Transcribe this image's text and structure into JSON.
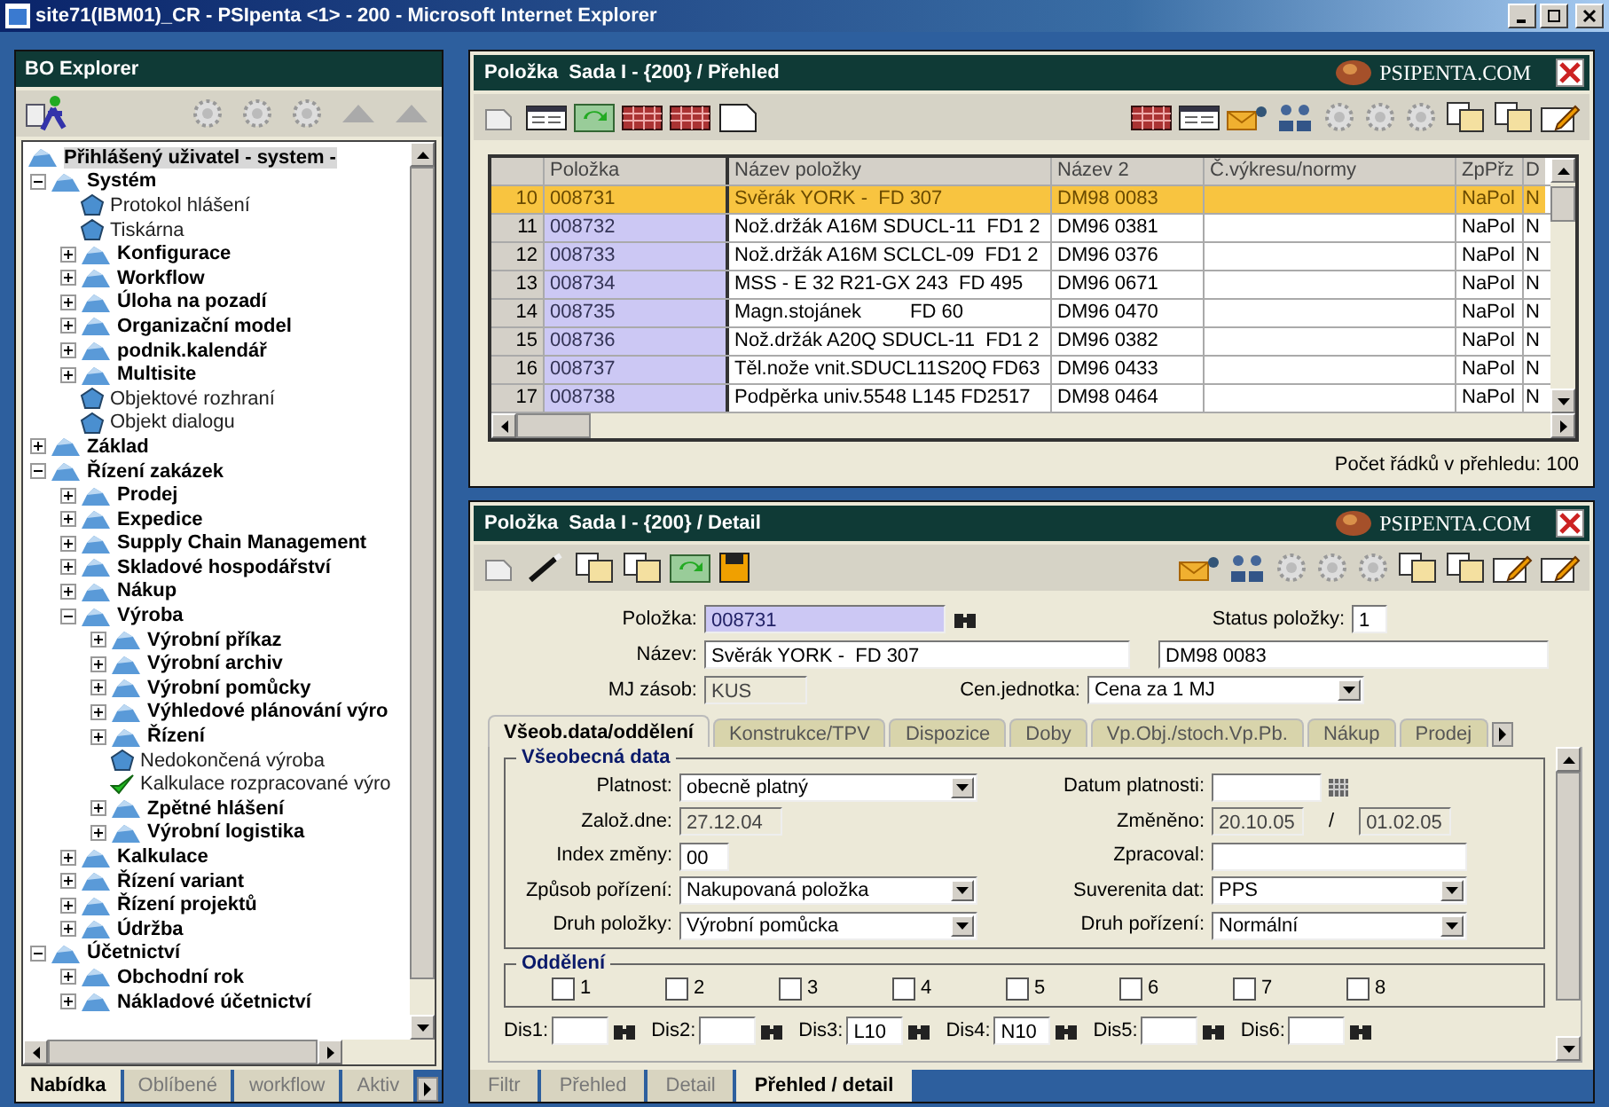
{
  "window": {
    "title": "site71(IBM01)_CR - PSIpenta <1> - 200 - Microsoft Internet Explorer"
  },
  "explorer": {
    "title": "BO Explorer",
    "tree": [
      {
        "label": "Přihlášený uživatel - system -",
        "kind": "root",
        "selected": true,
        "children": [
          {
            "label": "Systém",
            "kind": "folder",
            "expanded": true,
            "children": [
              {
                "label": "Protokol hlášení",
                "kind": "leaf"
              },
              {
                "label": "Tiskárna",
                "kind": "leaf"
              },
              {
                "label": "Konfigurace",
                "kind": "folder",
                "expanded": false
              },
              {
                "label": "Workflow",
                "kind": "folder",
                "expanded": false
              },
              {
                "label": "Úloha na pozadí",
                "kind": "folder",
                "expanded": false
              },
              {
                "label": "Organizační model",
                "kind": "folder",
                "expanded": false
              },
              {
                "label": "podnik.kalendář",
                "kind": "folder",
                "expanded": false
              },
              {
                "label": "Multisite",
                "kind": "folder",
                "expanded": false
              },
              {
                "label": "Objektové rozhraní",
                "kind": "leaf"
              },
              {
                "label": "Objekt dialogu",
                "kind": "leaf"
              }
            ]
          },
          {
            "label": "Základ",
            "kind": "folder",
            "expanded": false
          },
          {
            "label": "Řízení zakázek",
            "kind": "folder",
            "expanded": true,
            "children": [
              {
                "label": "Prodej",
                "kind": "folder",
                "expanded": false
              },
              {
                "label": "Expedice",
                "kind": "folder",
                "expanded": false
              },
              {
                "label": "Supply Chain Management",
                "kind": "folder",
                "expanded": false
              },
              {
                "label": "Skladové hospodářství",
                "kind": "folder",
                "expanded": false
              },
              {
                "label": "Nákup",
                "kind": "folder",
                "expanded": false
              },
              {
                "label": "Výroba",
                "kind": "folder",
                "expanded": true,
                "children": [
                  {
                    "label": "Výrobní příkaz",
                    "kind": "folder",
                    "expanded": false
                  },
                  {
                    "label": "Výrobní archiv",
                    "kind": "folder",
                    "expanded": false
                  },
                  {
                    "label": "Výrobní pomůcky",
                    "kind": "folder",
                    "expanded": false
                  },
                  {
                    "label": "Výhledové plánování výro",
                    "kind": "folder",
                    "expanded": false
                  },
                  {
                    "label": "Řízení",
                    "kind": "folder",
                    "expanded": false
                  },
                  {
                    "label": "Nedokončená výroba",
                    "kind": "leaf"
                  },
                  {
                    "label": "Kalkulace rozpracované výro",
                    "kind": "done"
                  },
                  {
                    "label": "Zpětné hlášení",
                    "kind": "folder",
                    "expanded": false
                  },
                  {
                    "label": "Výrobní logistika",
                    "kind": "folder",
                    "expanded": false
                  }
                ]
              },
              {
                "label": "Kalkulace",
                "kind": "folder",
                "expanded": false
              },
              {
                "label": "Řízení variant",
                "kind": "folder",
                "expanded": false
              },
              {
                "label": "Řízení projektů",
                "kind": "folder",
                "expanded": false
              },
              {
                "label": "Údržba",
                "kind": "folder",
                "expanded": false
              }
            ]
          },
          {
            "label": "Účetnictví",
            "kind": "folder",
            "expanded": true,
            "children": [
              {
                "label": "Obchodní rok",
                "kind": "folder",
                "expanded": false
              },
              {
                "label": "Nákladové účetnictví",
                "kind": "folder",
                "expanded": false
              }
            ]
          }
        ]
      }
    ],
    "tabs": [
      {
        "label": "Nabídka",
        "selected": true
      },
      {
        "label": "Oblíbené",
        "selected": false
      },
      {
        "label": "workflow",
        "selected": false
      },
      {
        "label": "Aktiv",
        "selected": false
      }
    ]
  },
  "overview": {
    "title": "Položka  Sada I - {200} / Přehled",
    "brand": "PSIPENTA.COM",
    "columns": [
      "Položka",
      "Název položky",
      "Název 2",
      "Č.výkresu/normy",
      "ZpPřz",
      "D"
    ],
    "rows": [
      {
        "num": "10",
        "item": "008731",
        "name": "Svěrák YORK -  FD 307",
        "name2": "DM98 0083",
        "zp": "NaPol",
        "d": "N",
        "selected": true
      },
      {
        "num": "11",
        "item": "008732",
        "name": "Nož.držák A16M SDUCL-11  FD1 2",
        "name2": "DM96 0381",
        "zp": "NaPol",
        "d": "N",
        "selected": false
      },
      {
        "num": "12",
        "item": "008733",
        "name": "Nož.držák A16M SCLCL-09  FD1 2",
        "name2": "DM96 0376",
        "zp": "NaPol",
        "d": "N",
        "selected": false
      },
      {
        "num": "13",
        "item": "008734",
        "name": "MSS - E 32 R21-GX 243  FD 495",
        "name2": "DM96 0671",
        "zp": "NaPol",
        "d": "N",
        "selected": false
      },
      {
        "num": "14",
        "item": "008735",
        "name": "Magn.stojánek         FD 60",
        "name2": "DM96 0470",
        "zp": "NaPol",
        "d": "N",
        "selected": false
      },
      {
        "num": "15",
        "item": "008736",
        "name": "Nož.držák A20Q SDUCL-11  FD1 2",
        "name2": "DM96 0382",
        "zp": "NaPol",
        "d": "N",
        "selected": false
      },
      {
        "num": "16",
        "item": "008737",
        "name": "Těl.nože vnit.SDUCL11S20Q FD63",
        "name2": "DM96 0433",
        "zp": "NaPol",
        "d": "N",
        "selected": false
      },
      {
        "num": "17",
        "item": "008738",
        "name": "Podpěrka univ.5548 L145 FD2517",
        "name2": "DM98 0464",
        "zp": "NaPol",
        "d": "N",
        "selected": false
      }
    ],
    "row_count": "Počet řádků v přehledu: 100"
  },
  "detail": {
    "title": "Položka  Sada I - {200} / Detail",
    "brand": "PSIPENTA.COM",
    "item": {
      "label": "Položka:",
      "value": "008731"
    },
    "status": {
      "label": "Status položky:",
      "value": "1"
    },
    "name": {
      "label": "Název:",
      "value": "Svěrák YORK -  FD 307"
    },
    "name2": {
      "value": "DM98 0083"
    },
    "stock_unit": {
      "label": "MJ zásob:",
      "value": "KUS"
    },
    "price_unit": {
      "label": "Cen.jednotka:",
      "value": "Cena za 1 MJ"
    },
    "tabs": [
      {
        "label": "Všeob.data/oddělení",
        "selected": true
      },
      {
        "label": "Konstrukce/TPV",
        "selected": false
      },
      {
        "label": "Dispozice",
        "selected": false
      },
      {
        "label": "Doby",
        "selected": false
      },
      {
        "label": "Vp.Obj./stoch.Vp.Pb.",
        "selected": false
      },
      {
        "label": "Nákup",
        "selected": false
      },
      {
        "label": "Prodej",
        "selected": false
      }
    ],
    "general": {
      "title": "Všeobecná data",
      "rows": [
        {
          "left": {
            "label": "Platnost:",
            "value": "obecně platný",
            "kind": "select"
          },
          "right": {
            "label": "Datum platnosti:",
            "kind": "date"
          }
        },
        {
          "left": {
            "label": "Založ.dne:",
            "value": "27.12.04",
            "kind": "readonly"
          },
          "right": {
            "label": "Změněno:",
            "value": "20.10.05",
            "kind": "readonly",
            "separator": "/",
            "value2": "01.02.05"
          }
        },
        {
          "left": {
            "label": "Index změny:",
            "value": "00",
            "kind": "short"
          },
          "right": {
            "label": "Zpracoval:",
            "kind": "text"
          }
        },
        {
          "left": {
            "label": "Způsob pořízení:",
            "value": "Nakupovaná položka",
            "kind": "select"
          },
          "right": {
            "label": "Suverenita dat:",
            "value": "PPS",
            "kind": "select"
          }
        },
        {
          "left": {
            "label": "Druh položky:",
            "value": "Výrobní pomůcka",
            "kind": "select"
          },
          "right": {
            "label": "Druh pořízení:",
            "value": "Normální",
            "kind": "select"
          }
        }
      ]
    },
    "departments": {
      "title": "Oddělení",
      "boxes": [
        {
          "label": "1",
          "checked": false
        },
        {
          "label": "2",
          "checked": false
        },
        {
          "label": "3",
          "checked": false
        },
        {
          "label": "4",
          "checked": false
        },
        {
          "label": "5",
          "checked": false
        },
        {
          "label": "6",
          "checked": false
        },
        {
          "label": "7",
          "checked": false
        },
        {
          "label": "8",
          "checked": false
        }
      ]
    },
    "dis": [
      {
        "label": "Dis1:"
      },
      {
        "label": "Dis2:"
      },
      {
        "label": "Dis3:",
        "value": "L10"
      },
      {
        "label": "Dis4:",
        "value": "N10"
      },
      {
        "label": "Dis5:"
      },
      {
        "label": "Dis6:"
      }
    ],
    "bottom_tabs": [
      {
        "label": "Filtr",
        "selected": false
      },
      {
        "label": "Přehled",
        "selected": false
      },
      {
        "label": "Detail",
        "selected": false
      },
      {
        "label": "Přehled / detail",
        "selected": true
      }
    ]
  }
}
